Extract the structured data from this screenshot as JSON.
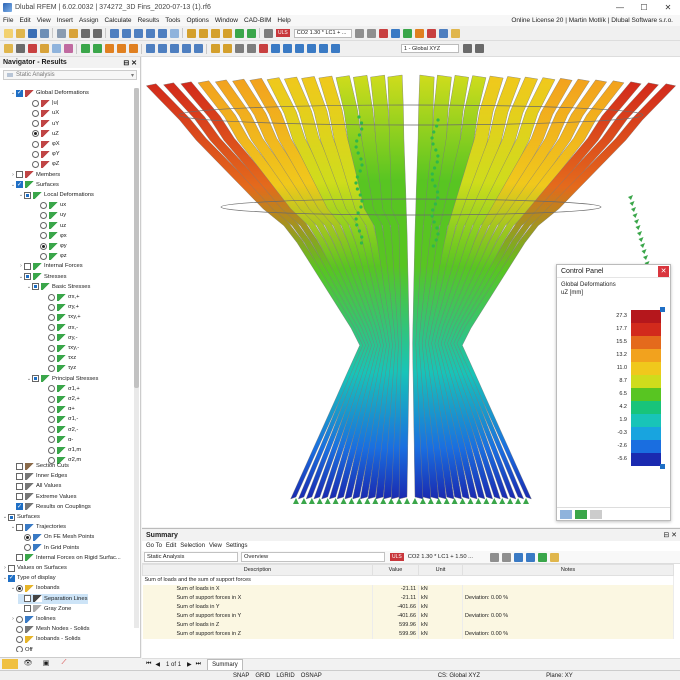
{
  "window": {
    "title": "Dlubal RFEM | 6.02.0032 | 374272_3D Fins_2020-07-13 (1).rf6",
    "license": "Online License 20 | Martin Motlík | Dlubal Software s.r.o."
  },
  "menu": [
    "File",
    "Edit",
    "View",
    "Insert",
    "Assign",
    "Calculate",
    "Results",
    "Tools",
    "Options",
    "Window",
    "CAD-BIM",
    "Help"
  ],
  "toolbar": {
    "uls": "ULS",
    "combo": "CO2",
    "loadcase": "1.30 * LC1 + ...",
    "coord": "1 - Global XYZ"
  },
  "navigator": {
    "title": "Navigator - Results",
    "combo": "Static Analysis",
    "items": [
      {
        "label": "Global Deformations",
        "t": "cb",
        "s": "on",
        "e": "v",
        "d": 1,
        "i": "#c04545"
      },
      {
        "label": "|u|",
        "t": "rd",
        "s": "",
        "d": 3,
        "i": "#c04545"
      },
      {
        "label": "uX",
        "t": "rd",
        "s": "",
        "d": 3,
        "i": "#c04545"
      },
      {
        "label": "uY",
        "t": "rd",
        "s": "",
        "d": 3,
        "i": "#c04545"
      },
      {
        "label": "uZ",
        "t": "rd",
        "s": "on",
        "d": 3,
        "i": "#c04545"
      },
      {
        "label": "φX",
        "t": "rd",
        "s": "",
        "d": 3,
        "i": "#c04545"
      },
      {
        "label": "φY",
        "t": "rd",
        "s": "",
        "d": 3,
        "i": "#c04545"
      },
      {
        "label": "φZ",
        "t": "rd",
        "s": "",
        "d": 3,
        "i": "#c04545"
      },
      {
        "label": "Members",
        "t": "cb",
        "s": "",
        "e": ">",
        "d": 1,
        "i": "#c04545"
      },
      {
        "label": "Surfaces",
        "t": "cb",
        "s": "on",
        "e": "v",
        "d": 1,
        "i": "#3aa64a"
      },
      {
        "label": "Local Deformations",
        "t": "cb",
        "s": "part",
        "e": "v",
        "d": 2,
        "i": "#3aa64a"
      },
      {
        "label": "ux",
        "t": "rd",
        "s": "",
        "d": 4,
        "i": "#3aa64a"
      },
      {
        "label": "uy",
        "t": "rd",
        "s": "",
        "d": 4,
        "i": "#3aa64a"
      },
      {
        "label": "uz",
        "t": "rd",
        "s": "",
        "d": 4,
        "i": "#3aa64a"
      },
      {
        "label": "φx",
        "t": "rd",
        "s": "",
        "d": 4,
        "i": "#3aa64a"
      },
      {
        "label": "φy",
        "t": "rd",
        "s": "on",
        "d": 4,
        "i": "#3aa64a"
      },
      {
        "label": "φz",
        "t": "rd",
        "s": "",
        "d": 4,
        "i": "#3aa64a"
      },
      {
        "label": "Internal Forces",
        "t": "cb",
        "s": "",
        "e": ">",
        "d": 2,
        "i": "#3aa64a"
      },
      {
        "label": "Stresses",
        "t": "cb",
        "s": "part",
        "e": "v",
        "d": 2,
        "i": "#3aa64a"
      },
      {
        "label": "Basic Stresses",
        "t": "cb",
        "s": "part",
        "e": "v",
        "d": 3,
        "i": "#3aa64a"
      },
      {
        "label": "σx,+",
        "t": "rd",
        "s": "",
        "d": 5,
        "i": "#3aa64a"
      },
      {
        "label": "σy,+",
        "t": "rd",
        "s": "",
        "d": 5,
        "i": "#3aa64a"
      },
      {
        "label": "τxy,+",
        "t": "rd",
        "s": "",
        "d": 5,
        "i": "#3aa64a"
      },
      {
        "label": "σx,-",
        "t": "rd",
        "s": "",
        "d": 5,
        "i": "#3aa64a"
      },
      {
        "label": "σy,-",
        "t": "rd",
        "s": "",
        "d": 5,
        "i": "#3aa64a"
      },
      {
        "label": "τxy,-",
        "t": "rd",
        "s": "",
        "d": 5,
        "i": "#3aa64a"
      },
      {
        "label": "τxz",
        "t": "rd",
        "s": "",
        "d": 5,
        "i": "#3aa64a"
      },
      {
        "label": "τyz",
        "t": "rd",
        "s": "",
        "d": 5,
        "i": "#3aa64a"
      },
      {
        "label": "Principal Stresses",
        "t": "cb",
        "s": "part",
        "e": "v",
        "d": 3,
        "i": "#3aa64a"
      },
      {
        "label": "σ1,+",
        "t": "rd",
        "s": "",
        "d": 5,
        "i": "#3aa64a"
      },
      {
        "label": "σ2,+",
        "t": "rd",
        "s": "",
        "d": 5,
        "i": "#3aa64a"
      },
      {
        "label": "α+",
        "t": "rd",
        "s": "",
        "d": 5,
        "i": "#3aa64a"
      },
      {
        "label": "σ1,-",
        "t": "rd",
        "s": "",
        "d": 5,
        "i": "#3aa64a"
      },
      {
        "label": "σ2,-",
        "t": "rd",
        "s": "",
        "d": 5,
        "i": "#3aa64a"
      },
      {
        "label": "α-",
        "t": "rd",
        "s": "",
        "d": 5,
        "i": "#3aa64a"
      },
      {
        "label": "σ1,m",
        "t": "rd",
        "s": "",
        "d": 5,
        "i": "#3aa64a"
      },
      {
        "label": "σ2,m",
        "t": "rd",
        "s": "",
        "d": 5,
        "i": "#3aa64a"
      }
    ],
    "items2": [
      {
        "label": "Section Cuts",
        "t": "cb",
        "s": "",
        "d": 1,
        "i": "#8a6a4a"
      },
      {
        "label": "Inner Edges",
        "t": "cb",
        "s": "",
        "d": 1,
        "i": "#777"
      },
      {
        "label": "All Values",
        "t": "cb",
        "s": "",
        "d": 1,
        "i": "#777"
      },
      {
        "label": "Extreme Values",
        "t": "cb",
        "s": "",
        "d": 1,
        "i": "#777"
      },
      {
        "label": "Results on Couplings",
        "t": "cb",
        "s": "on",
        "d": 1,
        "i": "#777"
      },
      {
        "label": "Surfaces",
        "t": "cb",
        "s": "part",
        "e": "v",
        "d": 0,
        "i": ""
      },
      {
        "label": "Trajectories",
        "t": "cb",
        "s": "",
        "e": "v",
        "d": 1,
        "i": "#3a7ac4"
      },
      {
        "label": "On FE Mesh Points",
        "t": "rd",
        "s": "on",
        "d": 2,
        "i": "#3a7ac4"
      },
      {
        "label": "In Grid Points",
        "t": "rd",
        "s": "",
        "d": 2,
        "i": "#3a7ac4"
      },
      {
        "label": "Internal Forces on Rigid Surfac...",
        "t": "cb",
        "s": "",
        "d": 1,
        "i": "#3aa64a"
      },
      {
        "label": "Values on Surfaces",
        "t": "cb",
        "s": "",
        "e": ">",
        "d": 0,
        "i": ""
      },
      {
        "label": "Type of display",
        "t": "cb",
        "s": "on",
        "e": "v",
        "d": 0,
        "i": ""
      },
      {
        "label": "Isobands",
        "t": "rd",
        "s": "on",
        "e": "v",
        "d": 1,
        "i": "#e7b52a"
      },
      {
        "label": "Separation Lines",
        "t": "cb",
        "s": "",
        "d": 2,
        "i": "#444",
        "sel": true
      },
      {
        "label": "Gray Zone",
        "t": "cb",
        "s": "",
        "d": 2,
        "i": "#aaa"
      },
      {
        "label": "Isolines",
        "t": "rd",
        "s": "",
        "e": ">",
        "d": 1,
        "i": "#3a7ac4"
      },
      {
        "label": "Mesh Nodes - Solids",
        "t": "rd",
        "s": "",
        "d": 1,
        "i": "#777"
      },
      {
        "label": "Isobands - Solids",
        "t": "rd",
        "s": "",
        "d": 1,
        "i": "#e7b52a"
      },
      {
        "label": "Off",
        "t": "rd",
        "s": "",
        "d": 1,
        "i": ""
      }
    ]
  },
  "control_panel": {
    "title": "Control Panel",
    "label1": "Global Deformations",
    "label2": "uZ [mm]",
    "legend": [
      {
        "v": "27.3",
        "c": "#b5171c"
      },
      {
        "v": "17.7",
        "c": "#d22a1c"
      },
      {
        "v": "15.5",
        "c": "#e46a1c"
      },
      {
        "v": "13.2",
        "c": "#f2a21e"
      },
      {
        "v": "11.0",
        "c": "#f0c81c"
      },
      {
        "v": "8.7",
        "c": "#cfdc1c"
      },
      {
        "v": "6.5",
        "c": "#58c522"
      },
      {
        "v": "4.2",
        "c": "#18c47a"
      },
      {
        "v": "1.9",
        "c": "#18c4b8"
      },
      {
        "v": "-0.3",
        "c": "#18a4df"
      },
      {
        "v": "-2.6",
        "c": "#1a6ee0"
      },
      {
        "v": "-5.6",
        "c": "#1a2ab0"
      }
    ]
  },
  "summary": {
    "title": "Summary",
    "menu": [
      "Go To",
      "Edit",
      "Selection",
      "View",
      "Settings"
    ],
    "combo1": "Static Analysis",
    "combo2": "Overview",
    "uls": "ULS",
    "co": "CO2",
    "lc": "1.30 * LC1 + 1.50 ...",
    "headers": [
      "Description",
      "Value",
      "Unit",
      "Notes"
    ],
    "group": "Sum of loads and the sum of support forces",
    "rows": [
      {
        "d": "Sum of loads in X",
        "v": "-21.11",
        "u": "kN",
        "n": ""
      },
      {
        "d": "Sum of support forces in X",
        "v": "-21.11",
        "u": "kN",
        "n": "Deviation: 0.00 %"
      },
      {
        "d": "Sum of loads in Y",
        "v": "-401.66",
        "u": "kN",
        "n": ""
      },
      {
        "d": "Sum of support forces in Y",
        "v": "-401.66",
        "u": "kN",
        "n": "Deviation: 0.00 %"
      },
      {
        "d": "Sum of loads in Z",
        "v": "599.96",
        "u": "kN",
        "n": ""
      },
      {
        "d": "Sum of support forces in Z",
        "v": "599.96",
        "u": "kN",
        "n": "Deviation: 0.00 %"
      }
    ],
    "page": "1 of 1",
    "tab": "Summary"
  },
  "status": {
    "snap": "SNAP",
    "grid": "GRID",
    "lgrid": "LGRID",
    "osnap": "OSNAP",
    "cs": "CS: Global XYZ",
    "plane": "Plane: XY"
  }
}
